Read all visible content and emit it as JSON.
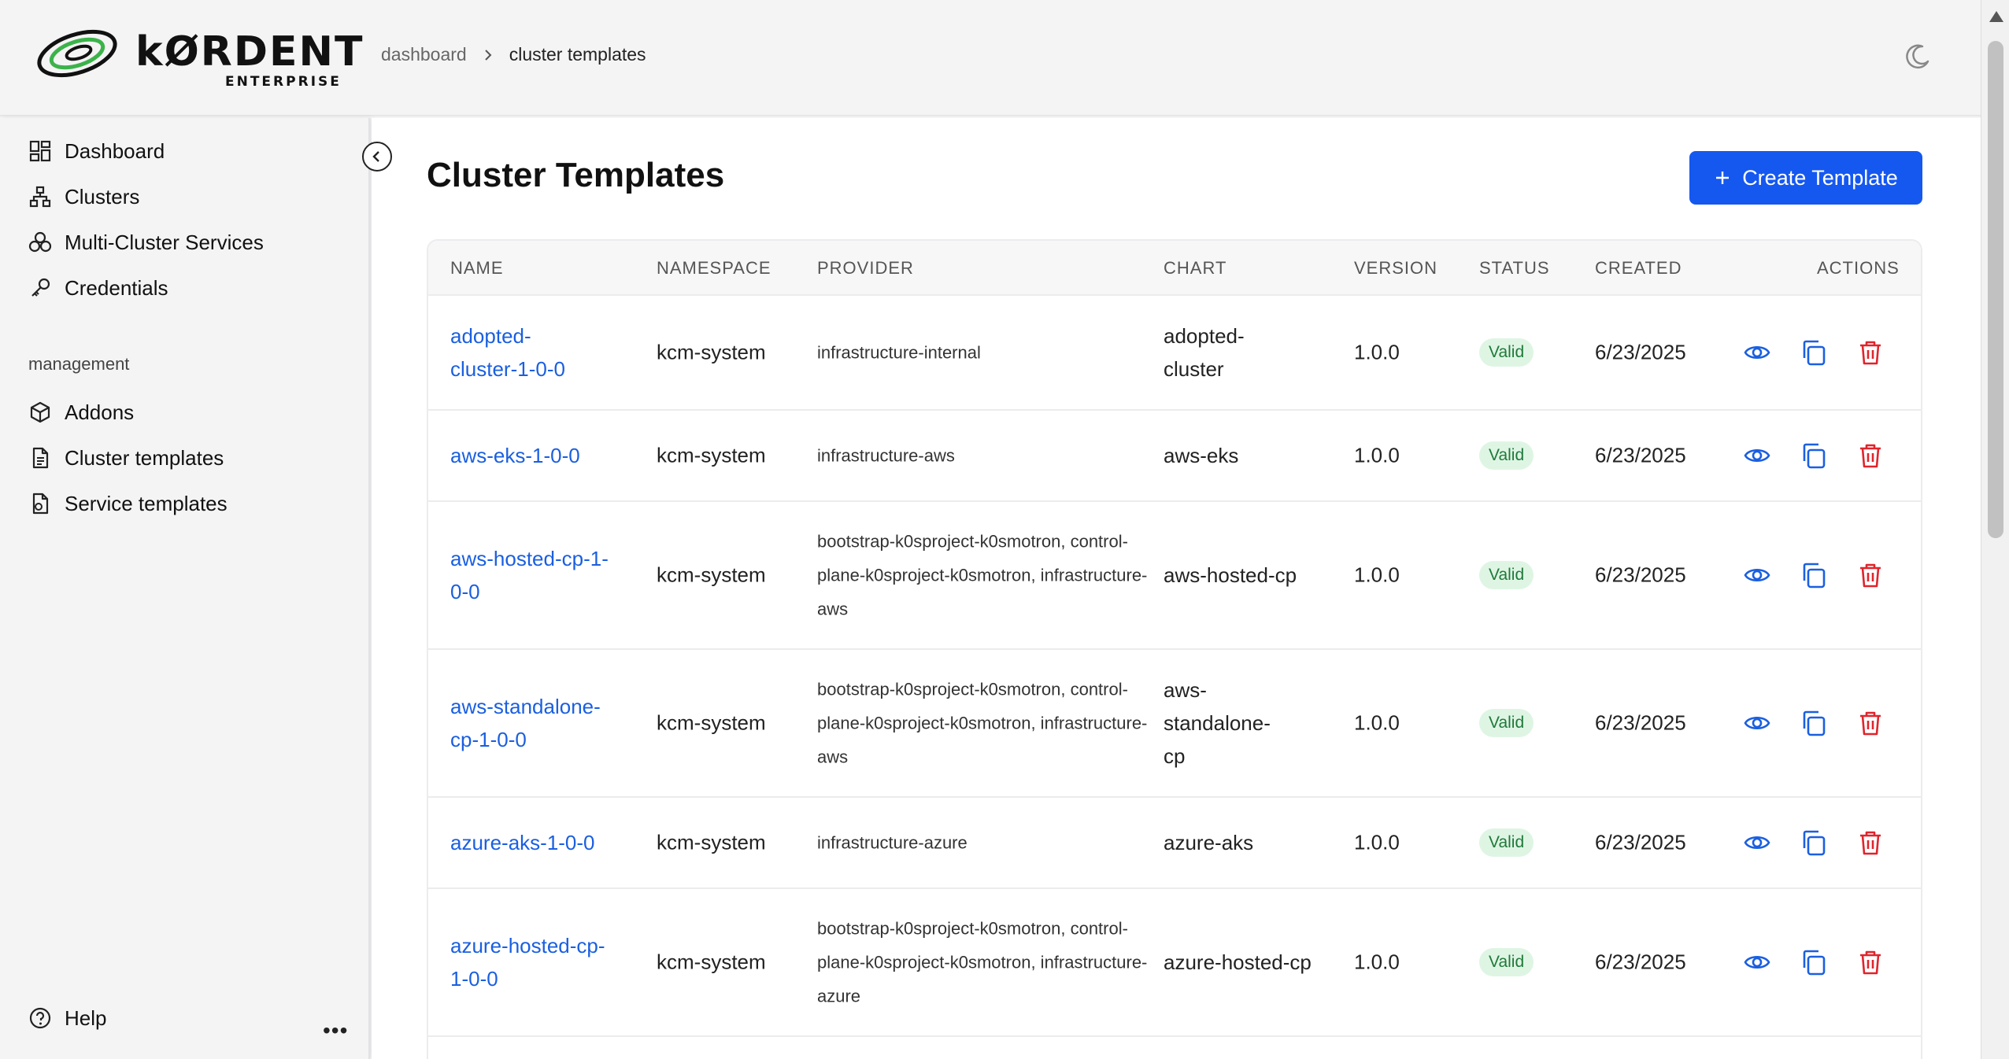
{
  "brand": {
    "name": "kØRDENT",
    "sub": "ENTERPRISE"
  },
  "breadcrumb": {
    "parent": "dashboard",
    "current": "cluster templates"
  },
  "sidebar": {
    "items": [
      {
        "label": "Dashboard",
        "icon": "dashboard-icon"
      },
      {
        "label": "Clusters",
        "icon": "clusters-icon"
      },
      {
        "label": "Multi-Cluster Services",
        "icon": "services-icon"
      },
      {
        "label": "Credentials",
        "icon": "key-icon"
      }
    ],
    "section_label": "management",
    "management_items": [
      {
        "label": "Addons",
        "icon": "box-icon"
      },
      {
        "label": "Cluster templates",
        "icon": "document-icon"
      },
      {
        "label": "Service templates",
        "icon": "service-template-icon"
      }
    ],
    "help_label": "Help",
    "more_label": "•••"
  },
  "page": {
    "title": "Cluster Templates",
    "create_label": "Create Template"
  },
  "table": {
    "headers": [
      "NAME",
      "NAMESPACE",
      "PROVIDER",
      "CHART",
      "VERSION",
      "STATUS",
      "CREATED",
      "ACTIONS"
    ],
    "rows": [
      {
        "name": "adopted-cluster-1-0-0",
        "namespace": "kcm-system",
        "provider": "infrastructure-internal",
        "chart": "adopted-cluster",
        "version": "1.0.0",
        "status": "Valid",
        "created": "6/23/2025"
      },
      {
        "name": "aws-eks-1-0-0",
        "namespace": "kcm-system",
        "provider": "infrastructure-aws",
        "chart": "aws-eks",
        "version": "1.0.0",
        "status": "Valid",
        "created": "6/23/2025"
      },
      {
        "name": "aws-hosted-cp-1-0-0",
        "namespace": "kcm-system",
        "provider": "bootstrap-k0sproject-k0smotron, control-plane-k0sproject-k0smotron, infrastructure-aws",
        "chart": "aws-hosted-cp",
        "version": "1.0.0",
        "status": "Valid",
        "created": "6/23/2025"
      },
      {
        "name": "aws-standalone-cp-1-0-0",
        "namespace": "kcm-system",
        "provider": "bootstrap-k0sproject-k0smotron, control-plane-k0sproject-k0smotron, infrastructure-aws",
        "chart": "aws-standalone-cp",
        "version": "1.0.0",
        "status": "Valid",
        "created": "6/23/2025"
      },
      {
        "name": "azure-aks-1-0-0",
        "namespace": "kcm-system",
        "provider": "infrastructure-azure",
        "chart": "azure-aks",
        "version": "1.0.0",
        "status": "Valid",
        "created": "6/23/2025"
      },
      {
        "name": "azure-hosted-cp-1-0-0",
        "namespace": "kcm-system",
        "provider": "bootstrap-k0sproject-k0smotron, control-plane-k0sproject-k0smotron, infrastructure-azure",
        "chart": "azure-hosted-cp",
        "version": "1.0.0",
        "status": "Valid",
        "created": "6/23/2025"
      }
    ]
  },
  "colors": {
    "accent": "#1558f0",
    "link": "#1a5fe0",
    "danger": "#e0242c",
    "valid_bg": "#dff5e4",
    "valid_fg": "#1f7a3a"
  }
}
